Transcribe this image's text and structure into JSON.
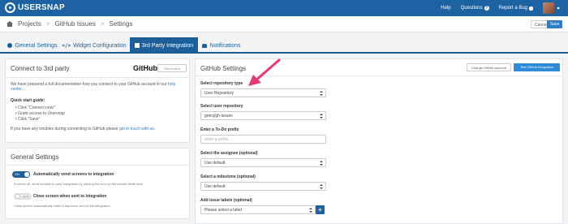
{
  "app": {
    "brand": "USERSNAP",
    "nav": {
      "help": "Help",
      "questions": "Questions",
      "report_bug": "Report a Bug"
    }
  },
  "breadcrumb": {
    "items": [
      "Projects",
      "GitHub Issues",
      "Settings"
    ],
    "separator": ">"
  },
  "actions": {
    "cancel": "Cancel",
    "save": "Save"
  },
  "tabs": [
    {
      "label": "General Settings",
      "icon": "circle-icon"
    },
    {
      "label": "Widget Configuration",
      "icon": "code-icon"
    },
    {
      "label": "3rd Party Integration",
      "icon": "puzzle-icon",
      "active": true
    },
    {
      "label": "Notifications",
      "icon": "bell-icon"
    }
  ],
  "connect_panel": {
    "title": "Connect to 3rd party",
    "provider_logo": "GitHub",
    "disconnect": "Disconnect",
    "intro": "We have prepared a full documentation how you connect to your GitHub account in our",
    "intro_link": "help center",
    "intro_end": ".",
    "quick_start_title": "Quick start guide:",
    "steps": [
      "Click \"Connect now!\"",
      "Grant access to Usersnap",
      "Click \"Save\""
    ],
    "trouble_text": "If you have any troubles during connecting to GitHub please",
    "trouble_link": "get in touch with us",
    "trouble_end": "."
  },
  "general_panel": {
    "title": "General Settings",
    "options": [
      {
        "toggle": "ON",
        "label": "Automatically send screens to integration",
        "desc": "If turned off, send screens to your integration by clicking the icon on the screen detail view."
      },
      {
        "toggle": "OFF",
        "label": "Close screen when sent to integration",
        "desc": "Close screen automatically when it has been sent to the integration."
      }
    ]
  },
  "github_panel": {
    "title": "GitHub Settings",
    "change_account": "Change GitHub Account",
    "test_integration": "Test GitHub Integration",
    "fields": {
      "repo_type": {
        "label": "Select repository type",
        "value": "User Repository"
      },
      "user_repo": {
        "label": "Select user repository",
        "value": "greicj/gh-issues"
      },
      "todo_prefix": {
        "label": "Enter a To-Do prefix",
        "placeholder": "enter a prefix"
      },
      "assignee": {
        "label": "Select the assignee (optional)",
        "value": "Use default"
      },
      "milestone": {
        "label": "Select a milestone (optional)",
        "value": "Use default"
      },
      "labels": {
        "label": "Add issue labels (optional)",
        "value": "Please select a label",
        "add": "+"
      }
    }
  },
  "colors": {
    "brand_blue": "#1d63a4",
    "tab_blue": "#1d5f9a",
    "button_blue": "#2f8ad8",
    "arrow_pink": "#e5396f"
  }
}
